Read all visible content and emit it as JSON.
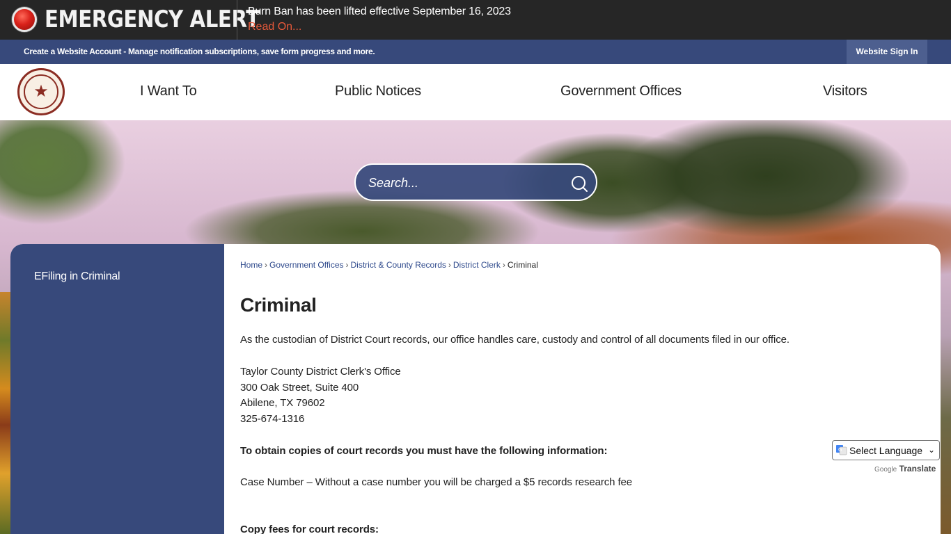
{
  "alert": {
    "title": "EMERGENCY ALERT",
    "message": "Burn Ban has been lifted effective September 16, 2023",
    "link": "Read On..."
  },
  "account_bar": {
    "text": "Create a Website Account - Manage notification subscriptions, save form progress and more.",
    "signin": "Website Sign In"
  },
  "nav": {
    "items": [
      "I Want To",
      "Public Notices",
      "Government Offices",
      "Visitors"
    ]
  },
  "search": {
    "placeholder": "Search..."
  },
  "sidebar": {
    "items": [
      "EFiling in Criminal"
    ]
  },
  "breadcrumb": [
    "Home",
    "Government Offices",
    "District & County Records",
    "District Clerk",
    "Criminal"
  ],
  "page": {
    "title": "Criminal",
    "intro": "As the custodian of District Court records, our office handles care, custody and control of all documents filed in our office.",
    "address_lines": [
      "Taylor County District Clerk's Office",
      "300 Oak Street, Suite 400",
      "Abilene, TX 79602",
      "325-674-1316"
    ],
    "copies_heading": "To obtain copies of court records you must have the following information:",
    "case_number": "Case Number – Without a case number you will be charged a $5 records research fee",
    "fees_heading": "Copy fees for court records:"
  },
  "translate": {
    "label": "Select Language",
    "powered_google": "Google",
    "powered_translate": "Translate"
  },
  "colors": {
    "alert_bg": "#262626",
    "brand_blue": "#37497b",
    "alert_link": "#e8593a"
  }
}
